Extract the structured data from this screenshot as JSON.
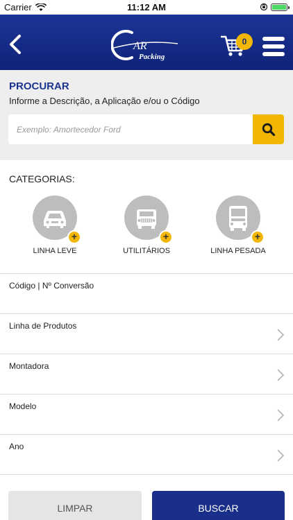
{
  "status_bar": {
    "carrier": "Carrier",
    "time": "11:12 AM",
    "battery_level": 1.0
  },
  "header": {
    "logo_text_big": "AR",
    "logo_text_small": "Packing",
    "cart_count": "0"
  },
  "search": {
    "title": "PROCURAR",
    "subtitle": "Informe a Descrição, a Aplicação e/ou o Código",
    "placeholder": "Exemplo: Amortecedor Ford",
    "value": ""
  },
  "categories": {
    "title": "CATEGORIAS:",
    "items": [
      {
        "label": "LINHA LEVE",
        "icon": "car-icon"
      },
      {
        "label": "UTILITÁRIOS",
        "icon": "jeep-icon"
      },
      {
        "label": "LINHA PESADA",
        "icon": "truck-icon"
      }
    ]
  },
  "filters": [
    {
      "label": "Código | Nº Conversão"
    },
    {
      "label": "Linha de Produtos"
    },
    {
      "label": "Montadora"
    },
    {
      "label": "Modelo"
    },
    {
      "label": "Ano"
    }
  ],
  "actions": {
    "clear_label": "LIMPAR",
    "search_label": "BUSCAR"
  },
  "colors": {
    "primary": "#1a2f8a",
    "accent": "#f2b705",
    "section_bg": "#eeeeee"
  }
}
